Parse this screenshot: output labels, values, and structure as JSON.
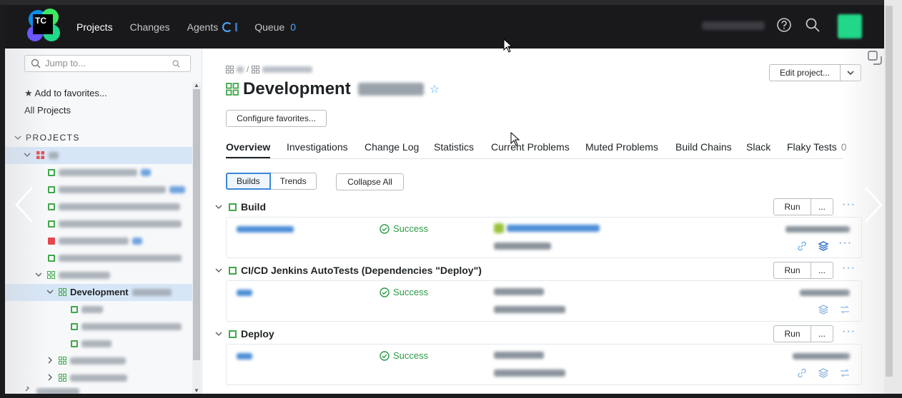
{
  "header": {
    "nav": [
      {
        "label": "Projects",
        "active": true
      },
      {
        "label": "Changes",
        "active": false
      },
      {
        "label": "Agents",
        "active": false
      },
      {
        "label": "Queue",
        "active": false,
        "count": "0"
      }
    ],
    "icons": [
      "help-icon",
      "search-icon"
    ],
    "logo_text": "TC"
  },
  "sidebar": {
    "search_placeholder": "Jump to...",
    "add_favorites": "★ Add to favorites...",
    "all_projects": "All Projects",
    "projects_header": "PROJECTS",
    "selected_project": "Development"
  },
  "main": {
    "title": "Development",
    "configure_favorites": "Configure favorites...",
    "edit_project": "Edit project...",
    "tabs": [
      {
        "label": "Overview",
        "active": true
      },
      {
        "label": "Investigations"
      },
      {
        "label": "Change Log"
      },
      {
        "label": "Statistics"
      },
      {
        "label": "Current Problems"
      },
      {
        "label": "Muted Problems"
      },
      {
        "label": "Build Chains"
      },
      {
        "label": "Slack"
      },
      {
        "label": "Flaky Tests",
        "count": "0"
      }
    ],
    "view_toggle": {
      "builds": "Builds",
      "trends": "Trends"
    },
    "collapse_all": "Collapse All",
    "build_configs": [
      {
        "name": "Build",
        "status": "Success",
        "run": "Run",
        "more": "..."
      },
      {
        "name": "CI/CD Jenkins AutoTests (Dependencies \"Deploy\")",
        "status": "Success",
        "run": "Run",
        "more": "..."
      },
      {
        "name": "Deploy",
        "status": "Success",
        "run": "Run",
        "more": "..."
      }
    ]
  },
  "colors": {
    "header_bg": "#19191c",
    "accent": "#4fa8ff",
    "success": "#2b9a43",
    "selected_row": "#d7e6f7"
  }
}
